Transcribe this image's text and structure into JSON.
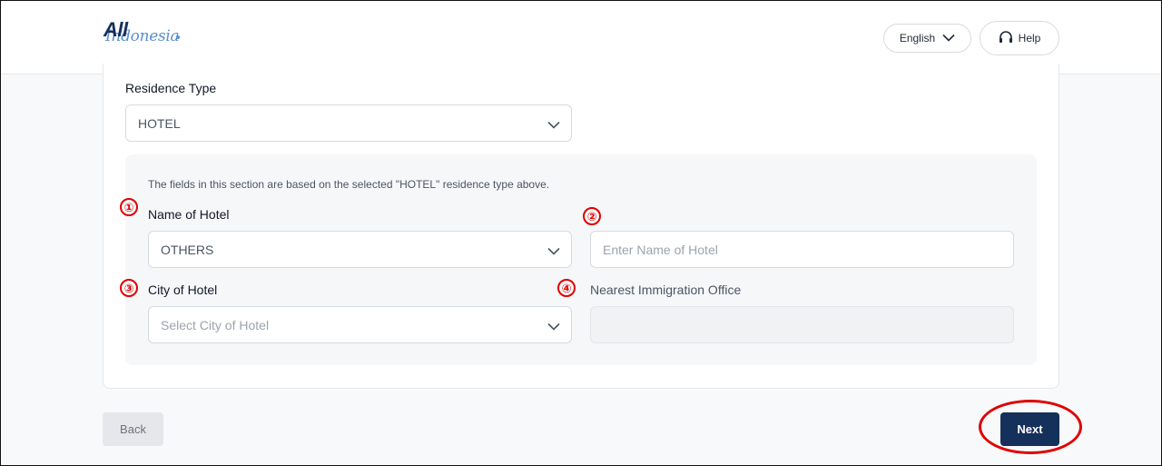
{
  "header": {
    "logo_main": "All",
    "logo_sub": "Indonesia",
    "language": "English",
    "help_label": "Help"
  },
  "form": {
    "residence_type_label": "Residence Type",
    "residence_type_value": "HOTEL",
    "section_note": "The fields in this section are based on the selected \"HOTEL\" residence type above.",
    "hotel_name_label": "Name of Hotel",
    "hotel_name_value": "OTHERS",
    "hotel_name_input_placeholder": "Enter Name of Hotel",
    "city_label": "City of Hotel",
    "city_placeholder": "Select City of Hotel",
    "immigration_label": "Nearest Immigration Office"
  },
  "annotations": [
    "①",
    "②",
    "③",
    "④"
  ],
  "footer": {
    "back_label": "Back",
    "next_label": "Next"
  },
  "colors": {
    "brand": "#15305a",
    "annotation": "#e00000"
  }
}
